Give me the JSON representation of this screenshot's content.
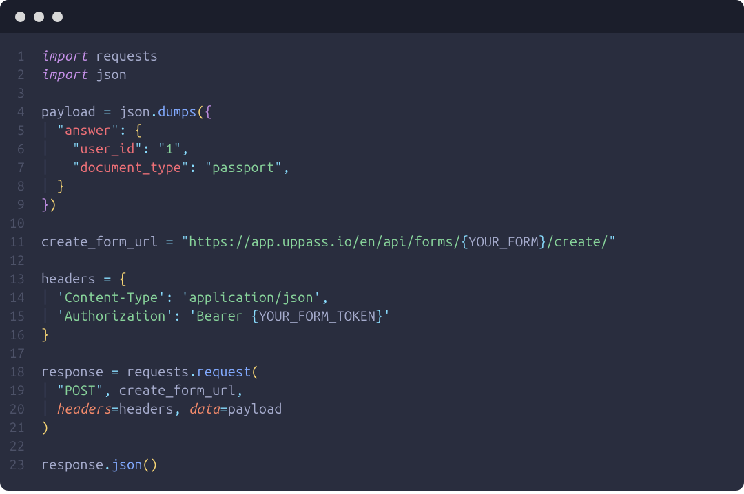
{
  "titlebar": {
    "dot_count": 3
  },
  "code": {
    "lines": [
      {
        "num": "1",
        "tokens": [
          {
            "t": "import ",
            "c": "kw"
          },
          {
            "t": "requests",
            "c": "default"
          }
        ]
      },
      {
        "num": "2",
        "tokens": [
          {
            "t": "import ",
            "c": "kw"
          },
          {
            "t": "json",
            "c": "default"
          }
        ]
      },
      {
        "num": "3",
        "tokens": []
      },
      {
        "num": "4",
        "tokens": [
          {
            "t": "payload ",
            "c": "default"
          },
          {
            "t": "=",
            "c": "op"
          },
          {
            "t": " json",
            "c": "default"
          },
          {
            "t": ".",
            "c": "punc"
          },
          {
            "t": "dumps",
            "c": "fn"
          },
          {
            "t": "(",
            "c": "paren"
          },
          {
            "t": "{",
            "c": "brace-p"
          }
        ]
      },
      {
        "num": "5",
        "tokens": [
          {
            "t": "  ",
            "c": "indent-guide"
          },
          {
            "t": "\"",
            "c": "str-q"
          },
          {
            "t": "answer",
            "c": "field"
          },
          {
            "t": "\"",
            "c": "str-q"
          },
          {
            "t": ":",
            "c": "punc"
          },
          {
            "t": " ",
            "c": "default"
          },
          {
            "t": "{",
            "c": "brace-y"
          }
        ]
      },
      {
        "num": "6",
        "tokens": [
          {
            "t": "    ",
            "c": "indent-guide2"
          },
          {
            "t": "\"",
            "c": "str-q"
          },
          {
            "t": "user_id",
            "c": "field"
          },
          {
            "t": "\"",
            "c": "str-q"
          },
          {
            "t": ":",
            "c": "punc"
          },
          {
            "t": " ",
            "c": "default"
          },
          {
            "t": "\"",
            "c": "str-q"
          },
          {
            "t": "1",
            "c": "str"
          },
          {
            "t": "\"",
            "c": "str-q"
          },
          {
            "t": ",",
            "c": "punc"
          }
        ]
      },
      {
        "num": "7",
        "tokens": [
          {
            "t": "    ",
            "c": "indent-guide2"
          },
          {
            "t": "\"",
            "c": "str-q"
          },
          {
            "t": "document_type",
            "c": "field"
          },
          {
            "t": "\"",
            "c": "str-q"
          },
          {
            "t": ":",
            "c": "punc"
          },
          {
            "t": " ",
            "c": "default"
          },
          {
            "t": "\"",
            "c": "str-q"
          },
          {
            "t": "passport",
            "c": "str"
          },
          {
            "t": "\"",
            "c": "str-q"
          },
          {
            "t": ",",
            "c": "punc"
          }
        ]
      },
      {
        "num": "8",
        "tokens": [
          {
            "t": "  ",
            "c": "indent-guide"
          },
          {
            "t": "}",
            "c": "brace-y"
          }
        ]
      },
      {
        "num": "9",
        "tokens": [
          {
            "t": "}",
            "c": "brace-p"
          },
          {
            "t": ")",
            "c": "paren"
          }
        ]
      },
      {
        "num": "10",
        "tokens": []
      },
      {
        "num": "11",
        "tokens": [
          {
            "t": "create_form_url ",
            "c": "default"
          },
          {
            "t": "=",
            "c": "op"
          },
          {
            "t": " ",
            "c": "default"
          },
          {
            "t": "\"",
            "c": "str-q"
          },
          {
            "t": "https://app.uppass.io/en/api/forms/",
            "c": "str"
          },
          {
            "t": "{",
            "c": "punc"
          },
          {
            "t": "YOUR_FORM",
            "c": "default"
          },
          {
            "t": "}",
            "c": "punc"
          },
          {
            "t": "/create/",
            "c": "str"
          },
          {
            "t": "\"",
            "c": "str-q"
          }
        ]
      },
      {
        "num": "12",
        "tokens": []
      },
      {
        "num": "13",
        "tokens": [
          {
            "t": "headers ",
            "c": "default"
          },
          {
            "t": "=",
            "c": "op"
          },
          {
            "t": " ",
            "c": "default"
          },
          {
            "t": "{",
            "c": "brace-y"
          }
        ]
      },
      {
        "num": "14",
        "tokens": [
          {
            "t": "  ",
            "c": "indent-guide"
          },
          {
            "t": "'",
            "c": "str-q"
          },
          {
            "t": "Content-Type",
            "c": "str"
          },
          {
            "t": "'",
            "c": "str-q"
          },
          {
            "t": ":",
            "c": "punc"
          },
          {
            "t": " ",
            "c": "default"
          },
          {
            "t": "'",
            "c": "str-q"
          },
          {
            "t": "application/json",
            "c": "str"
          },
          {
            "t": "'",
            "c": "str-q"
          },
          {
            "t": ",",
            "c": "punc"
          }
        ]
      },
      {
        "num": "15",
        "tokens": [
          {
            "t": "  ",
            "c": "indent-guide"
          },
          {
            "t": "'",
            "c": "str-q"
          },
          {
            "t": "Authorization",
            "c": "str"
          },
          {
            "t": "'",
            "c": "str-q"
          },
          {
            "t": ":",
            "c": "punc"
          },
          {
            "t": " ",
            "c": "default"
          },
          {
            "t": "'",
            "c": "str-q"
          },
          {
            "t": "Bearer ",
            "c": "str"
          },
          {
            "t": "{",
            "c": "punc"
          },
          {
            "t": "YOUR_FORM_TOKEN",
            "c": "default"
          },
          {
            "t": "}",
            "c": "punc"
          },
          {
            "t": "'",
            "c": "str-q"
          }
        ]
      },
      {
        "num": "16",
        "tokens": [
          {
            "t": "}",
            "c": "brace-y"
          }
        ]
      },
      {
        "num": "17",
        "tokens": []
      },
      {
        "num": "18",
        "tokens": [
          {
            "t": "response ",
            "c": "default"
          },
          {
            "t": "=",
            "c": "op"
          },
          {
            "t": " requests",
            "c": "default"
          },
          {
            "t": ".",
            "c": "punc"
          },
          {
            "t": "request",
            "c": "fn"
          },
          {
            "t": "(",
            "c": "paren"
          }
        ]
      },
      {
        "num": "19",
        "tokens": [
          {
            "t": "  ",
            "c": "indent-guide"
          },
          {
            "t": "\"",
            "c": "str-q"
          },
          {
            "t": "POST",
            "c": "str"
          },
          {
            "t": "\"",
            "c": "str-q"
          },
          {
            "t": ",",
            "c": "punc"
          },
          {
            "t": " create_form_url",
            "c": "default"
          },
          {
            "t": ",",
            "c": "punc"
          }
        ]
      },
      {
        "num": "20",
        "tokens": [
          {
            "t": "  ",
            "c": "indent-guide"
          },
          {
            "t": "headers",
            "c": "param"
          },
          {
            "t": "=",
            "c": "op"
          },
          {
            "t": "headers",
            "c": "default"
          },
          {
            "t": ",",
            "c": "punc"
          },
          {
            "t": " ",
            "c": "default"
          },
          {
            "t": "data",
            "c": "param"
          },
          {
            "t": "=",
            "c": "op"
          },
          {
            "t": "payload",
            "c": "default"
          }
        ]
      },
      {
        "num": "21",
        "tokens": [
          {
            "t": ")",
            "c": "paren"
          }
        ]
      },
      {
        "num": "22",
        "tokens": []
      },
      {
        "num": "23",
        "tokens": [
          {
            "t": "response",
            "c": "default"
          },
          {
            "t": ".",
            "c": "punc"
          },
          {
            "t": "json",
            "c": "fn"
          },
          {
            "t": "()",
            "c": "paren"
          }
        ]
      }
    ]
  }
}
